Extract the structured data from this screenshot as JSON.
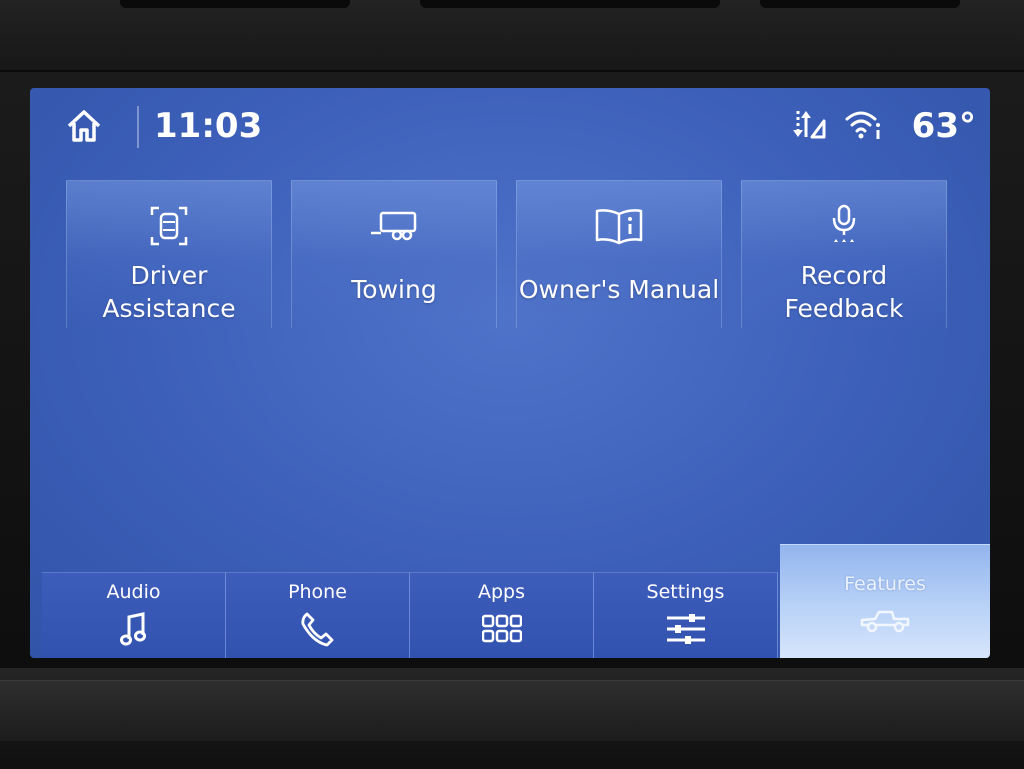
{
  "status_bar": {
    "time": "11:03",
    "temperature": "63°",
    "icons": [
      "home-icon",
      "data-signal-icon",
      "wifi-hotspot-icon"
    ]
  },
  "tiles": [
    {
      "label_line1": "Driver",
      "label_line2": "Assistance",
      "icon": "driver-assist-icon"
    },
    {
      "label": "Towing",
      "icon": "trailer-icon"
    },
    {
      "label": "Owner's Manual",
      "icon": "manual-book-icon"
    },
    {
      "label_line1": "Record",
      "label_line2": "Feedback",
      "icon": "microphone-icon"
    }
  ],
  "nav": {
    "items": [
      {
        "label": "Audio",
        "icon": "music-note-icon"
      },
      {
        "label": "Phone",
        "icon": "phone-icon"
      },
      {
        "label": "Apps",
        "icon": "apps-grid-icon"
      },
      {
        "label": "Settings",
        "icon": "sliders-icon"
      },
      {
        "label": "Features",
        "icon": "truck-icon",
        "active": true
      }
    ]
  },
  "colors": {
    "screen_blue": "#3c5fb9",
    "active_tab": "#b9d2f7",
    "text": "#ffffff"
  }
}
